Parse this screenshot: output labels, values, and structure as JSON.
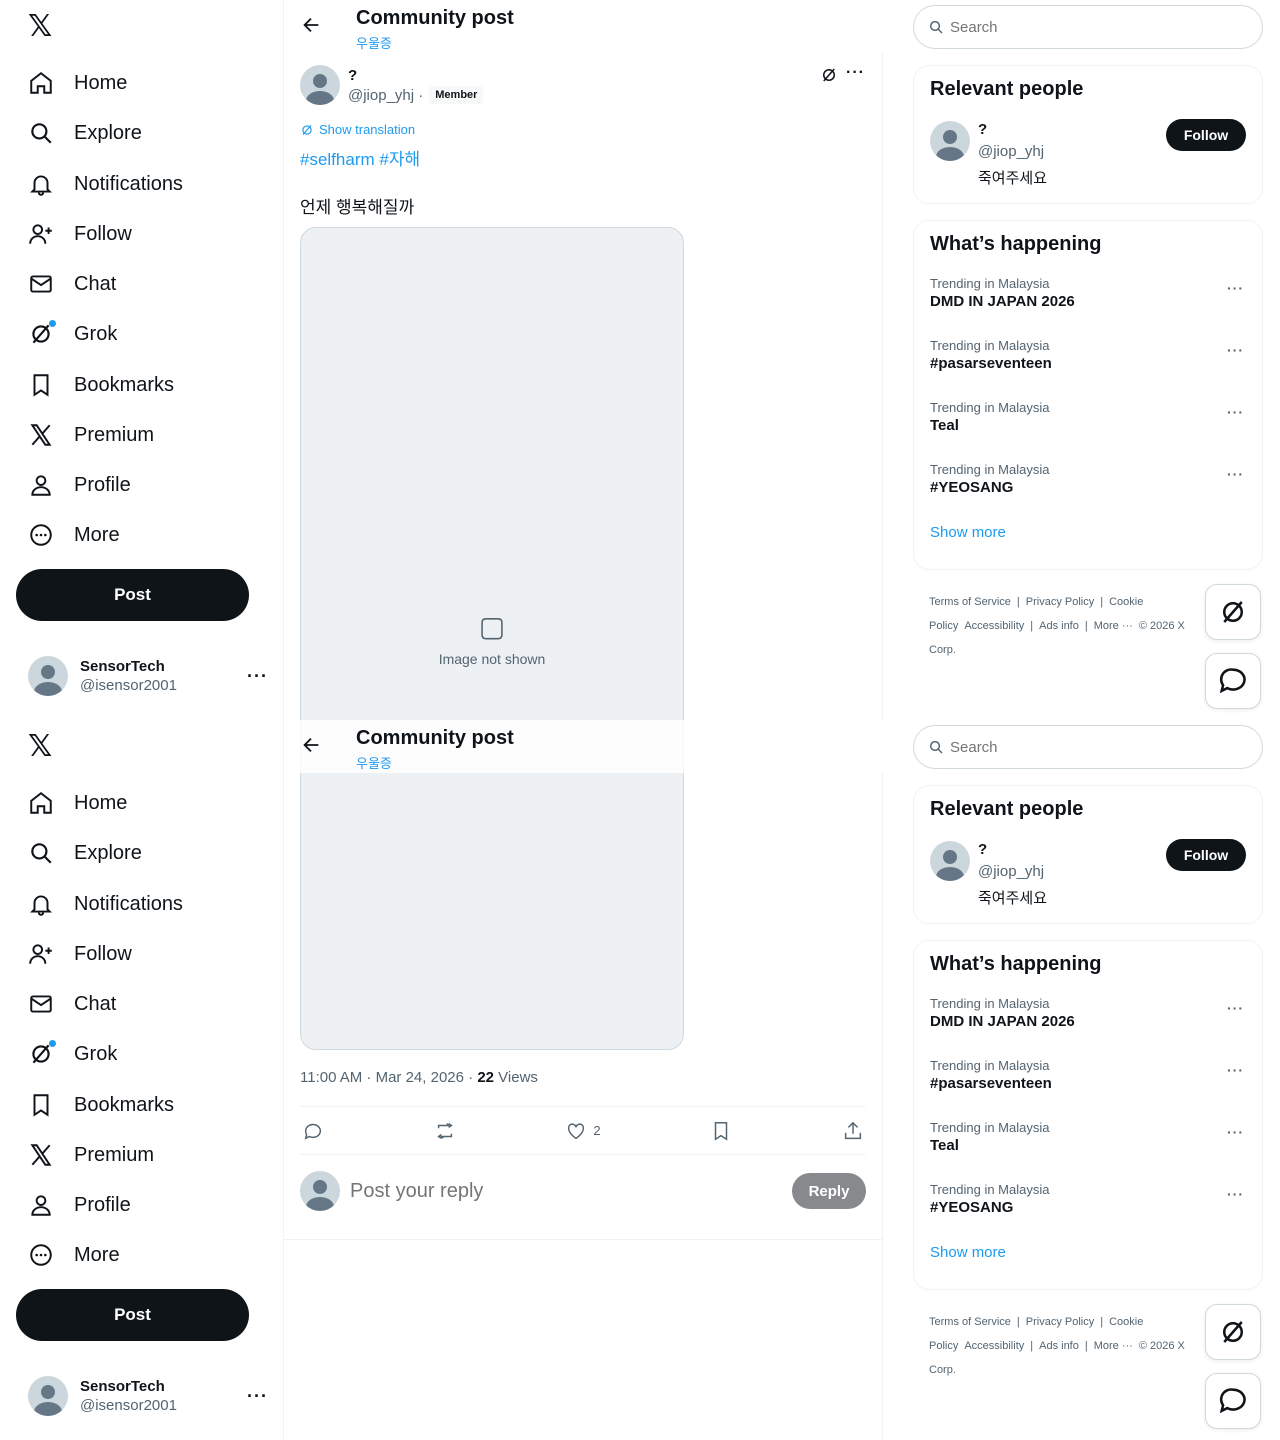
{
  "nav": {
    "items": [
      {
        "label": "Home",
        "icon": "home-icon"
      },
      {
        "label": "Explore",
        "icon": "search-icon"
      },
      {
        "label": "Notifications",
        "icon": "bell-icon"
      },
      {
        "label": "Follow",
        "icon": "person-plus-icon"
      },
      {
        "label": "Chat",
        "icon": "envelope-icon"
      },
      {
        "label": "Grok",
        "icon": "grok-icon"
      },
      {
        "label": "Bookmarks",
        "icon": "bookmark-icon"
      },
      {
        "label": "Premium",
        "icon": "x-logo-icon"
      },
      {
        "label": "Profile",
        "icon": "person-icon"
      },
      {
        "label": "More",
        "icon": "more-circle-icon"
      }
    ],
    "post_label": "Post",
    "account": {
      "name": "SensorTech",
      "handle": "@isensor2001"
    }
  },
  "header": {
    "title": "Community post",
    "subtitle": "우울증"
  },
  "post": {
    "author_name": "?",
    "author_handle": "@jiop_yhj",
    "separator": "·",
    "badge": "Member",
    "show_translation": "Show translation",
    "hashtags": "#selfharm #자해",
    "text": "언제 행복해질까",
    "media_notice": "Image not shown",
    "time": "11:00 AM · Mar 24, 2026 · ",
    "views_count": "22",
    "views_label": " Views",
    "likes": "2",
    "reply_placeholder": "Post your reply",
    "reply_button": "Reply"
  },
  "right": {
    "search_placeholder": "Search",
    "relevant_title": "Relevant people",
    "relevant_person": {
      "name": "?",
      "handle": "@jiop_yhj",
      "bio": "죽여주세요",
      "follow": "Follow"
    },
    "happening_title": "What’s happening",
    "trends": [
      {
        "context": "Trending in Malaysia",
        "name": "DMD IN JAPAN 2026"
      },
      {
        "context": "Trending in Malaysia",
        "name": "#pasarseventeen"
      },
      {
        "context": "Trending in Malaysia",
        "name": "Teal"
      },
      {
        "context": "Trending in Malaysia",
        "name": "#YEOSANG"
      }
    ],
    "show_more": "Show more",
    "footer": [
      "Terms of Service",
      "|",
      "Privacy Policy",
      "|",
      "Cookie Policy",
      "Accessibility",
      "|",
      "Ads info",
      "|",
      "More ···",
      "© 2026 X Corp."
    ]
  }
}
